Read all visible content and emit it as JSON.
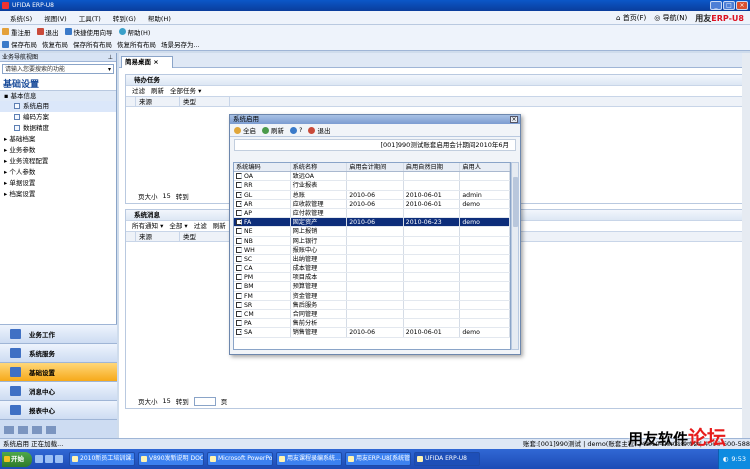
{
  "window": {
    "title": "UFIDA ERP-U8",
    "minimize": "_",
    "maximize": "□",
    "close": "×"
  },
  "menu": {
    "items": [
      "系统(S)",
      "视图(V)",
      "工具(T)",
      "转到(G)",
      "帮助(H)"
    ],
    "home": "首页(F)",
    "nav": "导航(N)",
    "brand_prefix": "用友",
    "brand_suffix": "ERP-U8"
  },
  "toolbar": {
    "row1": [
      "重注册",
      "退出",
      "快捷使用向导",
      "帮助(H)"
    ],
    "row2": [
      "保存布局",
      "恢复布局",
      "保存所有布局",
      "恢复所有布局",
      "场景另存为..."
    ]
  },
  "sidebar": {
    "header": "业务导航视图",
    "search_placeholder": "请输入您要搜索的功能",
    "title": "基础设置",
    "tree": [
      {
        "label": "基本信息",
        "type": "hdr"
      },
      {
        "label": "系统启用",
        "type": "leaf",
        "selected": true
      },
      {
        "label": "编码方案",
        "type": "leaf"
      },
      {
        "label": "数据精度",
        "type": "leaf"
      },
      {
        "label": "基础档案",
        "type": "group"
      },
      {
        "label": "业务参数",
        "type": "group"
      },
      {
        "label": "业务流程配置",
        "type": "group"
      },
      {
        "label": "个人参数",
        "type": "group"
      },
      {
        "label": "单据设置",
        "type": "group"
      },
      {
        "label": "档案设置",
        "type": "group"
      }
    ],
    "nav_buttons": [
      "业务工作",
      "系统服务",
      "基础设置",
      "消息中心",
      "报表中心"
    ],
    "active_nav": "基础设置"
  },
  "main": {
    "tab": "简易桌面",
    "tasks": {
      "title": "待办任务",
      "bar": [
        "过滤",
        "刷新",
        "全部任务 ▾"
      ],
      "columns": [
        "来源",
        "类型"
      ],
      "page_size_label": "页大小",
      "page_size": "15",
      "goto_label": "转到",
      "page_label": "页"
    },
    "messages": {
      "title": "系统消息",
      "bar": [
        "所有通知 ▾",
        "全部 ▾",
        "过滤",
        "刷新"
      ],
      "columns": [
        "来源",
        "类型"
      ],
      "page_size_label": "页大小",
      "page_size": "15",
      "goto_label": "转到",
      "page_label": "页"
    }
  },
  "dialog": {
    "title": "系统启用",
    "toolbar": [
      "全启",
      "刷新",
      "?",
      "退出"
    ],
    "info": "[001]990测试账套启用会计期间2010年6月",
    "columns": [
      "系统编码",
      "系统名称",
      "启用会计期间",
      "启用自然日期",
      "启用人"
    ],
    "rows": [
      {
        "code": "OA",
        "name": "致远OA",
        "period": "",
        "date": "",
        "user": "",
        "checked": false
      },
      {
        "code": "RR",
        "name": "行业报表",
        "period": "",
        "date": "",
        "user": "",
        "checked": false
      },
      {
        "code": "GL",
        "name": "总账",
        "period": "2010-06",
        "date": "2010-06-01",
        "user": "admin",
        "checked": true
      },
      {
        "code": "AR",
        "name": "应收款管理",
        "period": "2010-06",
        "date": "2010-06-01",
        "user": "demo",
        "checked": true
      },
      {
        "code": "AP",
        "name": "应付款管理",
        "period": "",
        "date": "",
        "user": "",
        "checked": false
      },
      {
        "code": "FA",
        "name": "固定资产",
        "period": "2010-06",
        "date": "2010-06-23",
        "user": "demo",
        "checked": true,
        "selected": true
      },
      {
        "code": "NE",
        "name": "网上报销",
        "period": "",
        "date": "",
        "user": "",
        "checked": false
      },
      {
        "code": "NB",
        "name": "网上银行",
        "period": "",
        "date": "",
        "user": "",
        "checked": false
      },
      {
        "code": "WH",
        "name": "报账中心",
        "period": "",
        "date": "",
        "user": "",
        "checked": false
      },
      {
        "code": "SC",
        "name": "出纳管理",
        "period": "",
        "date": "",
        "user": "",
        "checked": false
      },
      {
        "code": "CA",
        "name": "成本管理",
        "period": "",
        "date": "",
        "user": "",
        "checked": false
      },
      {
        "code": "PM",
        "name": "项目成本",
        "period": "",
        "date": "",
        "user": "",
        "checked": false
      },
      {
        "code": "BM",
        "name": "预算管理",
        "period": "",
        "date": "",
        "user": "",
        "checked": false
      },
      {
        "code": "FM",
        "name": "资金管理",
        "period": "",
        "date": "",
        "user": "",
        "checked": false
      },
      {
        "code": "SR",
        "name": "售后服务",
        "period": "",
        "date": "",
        "user": "",
        "checked": false
      },
      {
        "code": "CM",
        "name": "合同管理",
        "period": "",
        "date": "",
        "user": "",
        "checked": false
      },
      {
        "code": "PA",
        "name": "售前分析",
        "period": "",
        "date": "",
        "user": "",
        "checked": false
      },
      {
        "code": "SA",
        "name": "销售管理",
        "period": "2010-06",
        "date": "2010-06-01",
        "user": "demo",
        "checked": true
      }
    ]
  },
  "status": {
    "left": "系统启用  正在加载...",
    "right": "账套:[001]990测试 | demo(账套主管) | 2010-06-01 9:52 | 4006-600-588"
  },
  "taskbar": {
    "start": "开始",
    "buttons": [
      "2010新员工培训课...",
      "V890发新说明 DOC...",
      "Microsoft PowerPo...",
      "用友课程录编系统...",
      "用友ERP-U8[系统管理]",
      "UFIDA ERP-U8"
    ],
    "clock": "9:53"
  },
  "watermark": {
    "text_prefix": "用友软件",
    "text_suffix": "论坛",
    "url": "www.ufidaerp.com.cn"
  }
}
